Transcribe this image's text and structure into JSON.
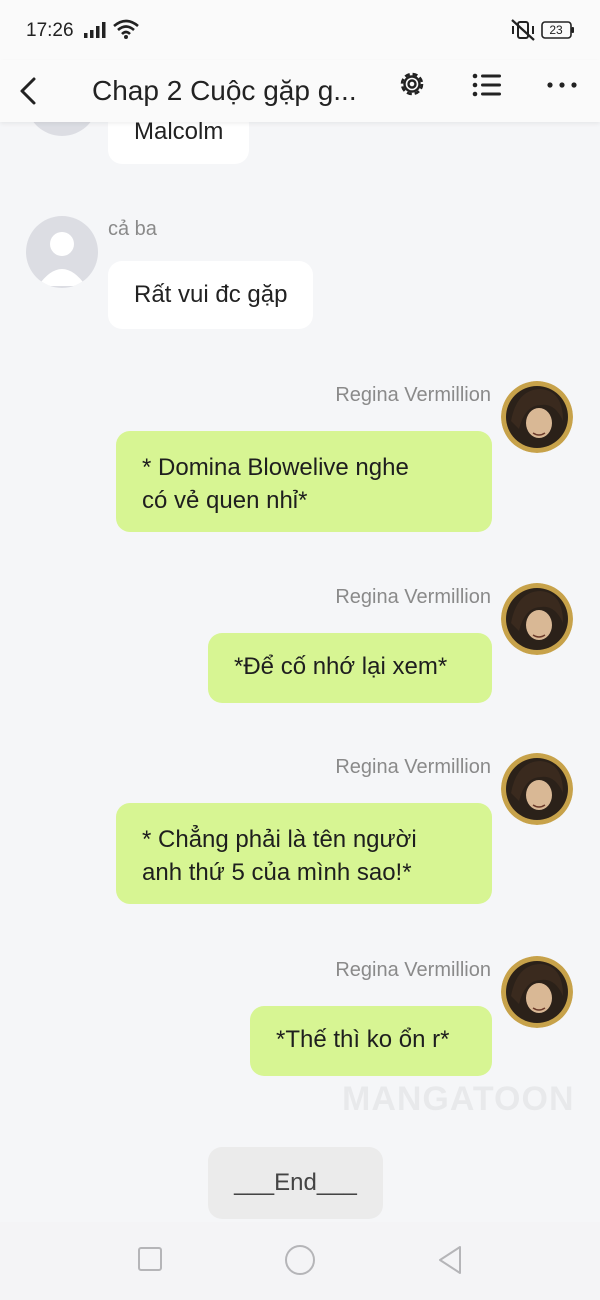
{
  "status": {
    "time": "17:26",
    "battery": "23"
  },
  "header": {
    "title": "Chap 2 Cuộc gặp g..."
  },
  "messages": [
    {
      "side": "left",
      "sender": "",
      "text": "Malcolm"
    },
    {
      "side": "left",
      "sender": "cả ba",
      "text": "Rất vui đc gặp"
    },
    {
      "side": "right",
      "sender": "Regina Vermillion",
      "text_lines": [
        "* Domina Blowelive nghe",
        "có vẻ quen nhỉ*"
      ]
    },
    {
      "side": "right",
      "sender": "Regina Vermillion",
      "text": "*Để cố nhớ lại xem*"
    },
    {
      "side": "right",
      "sender": "Regina Vermillion",
      "text_lines": [
        "* Chẳng phải là tên người",
        "anh thứ 5 của mình sao!*"
      ]
    },
    {
      "side": "right",
      "sender": "Regina Vermillion",
      "text": "*Thế thì ko ổn r*"
    }
  ],
  "watermark": "MANGATOON",
  "end_label": "___End___",
  "colors": {
    "right_bubble": "#d7f593",
    "left_bubble": "#ffffff",
    "background": "#f5f6f8"
  },
  "icons": [
    "signal-icon",
    "wifi-icon",
    "mute-icon",
    "battery-icon",
    "back-icon",
    "gear-icon",
    "list-icon",
    "more-icon"
  ]
}
